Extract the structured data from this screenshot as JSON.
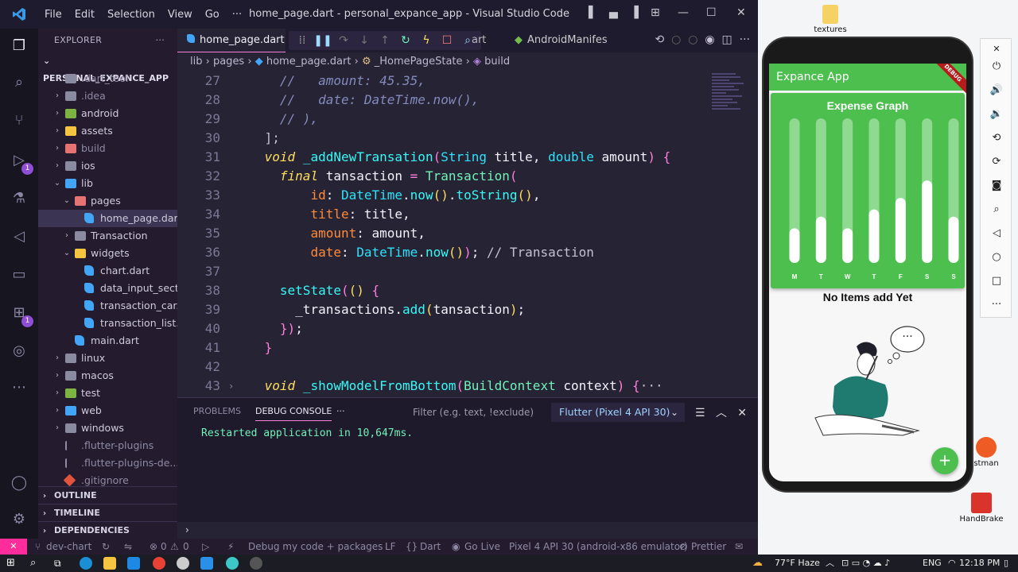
{
  "window": {
    "title": "home_page.dart - personal_expance_app - Visual Studio Code",
    "menu": [
      "File",
      "Edit",
      "Selection",
      "View",
      "Go",
      "···"
    ]
  },
  "activity_badges": [
    "1",
    "1"
  ],
  "explorer": {
    "title": "EXPLORER",
    "more": "···",
    "project": "PERSONAL_EXPANCE_APP",
    "tree": [
      {
        "label": ".dart_tool",
        "depth": 1,
        "chev": "›",
        "icon": "folder-gray",
        "dim": true
      },
      {
        "label": ".idea",
        "depth": 1,
        "chev": "›",
        "icon": "folder-gray",
        "dim": true
      },
      {
        "label": "android",
        "depth": 1,
        "chev": "›",
        "icon": "folder-green"
      },
      {
        "label": "assets",
        "depth": 1,
        "chev": "›",
        "icon": "folder-yellow"
      },
      {
        "label": "build",
        "depth": 1,
        "chev": "›",
        "icon": "folder-red",
        "dim": true
      },
      {
        "label": "ios",
        "depth": 1,
        "chev": "›",
        "icon": "folder-gray"
      },
      {
        "label": "lib",
        "depth": 1,
        "chev": "⌄",
        "icon": "folder-blue"
      },
      {
        "label": "pages",
        "depth": 2,
        "chev": "⌄",
        "icon": "folder-red"
      },
      {
        "label": "home_page.dart",
        "depth": 3,
        "chev": "",
        "icon": "dart",
        "selected": true
      },
      {
        "label": "Transaction",
        "depth": 2,
        "chev": "›",
        "icon": "folder-gray"
      },
      {
        "label": "widgets",
        "depth": 2,
        "chev": "⌄",
        "icon": "folder-yellow"
      },
      {
        "label": "chart.dart",
        "depth": 3,
        "chev": "",
        "icon": "dart"
      },
      {
        "label": "data_input_secti...",
        "depth": 3,
        "chev": "",
        "icon": "dart"
      },
      {
        "label": "transaction_car...",
        "depth": 3,
        "chev": "",
        "icon": "dart"
      },
      {
        "label": "transaction_list...",
        "depth": 3,
        "chev": "",
        "icon": "dart"
      },
      {
        "label": "main.dart",
        "depth": 2,
        "chev": "",
        "icon": "dart"
      },
      {
        "label": "linux",
        "depth": 1,
        "chev": "›",
        "icon": "folder-gray"
      },
      {
        "label": "macos",
        "depth": 1,
        "chev": "›",
        "icon": "folder-gray"
      },
      {
        "label": "test",
        "depth": 1,
        "chev": "›",
        "icon": "folder-green"
      },
      {
        "label": "web",
        "depth": 1,
        "chev": "›",
        "icon": "folder-blue"
      },
      {
        "label": "windows",
        "depth": 1,
        "chev": "›",
        "icon": "folder-gray"
      },
      {
        "label": ".flutter-plugins",
        "depth": 1,
        "chev": "",
        "icon": "file",
        "dim": true
      },
      {
        "label": ".flutter-plugins-de...",
        "depth": 1,
        "chev": "",
        "icon": "file",
        "dim": true
      },
      {
        "label": ".gitignore",
        "depth": 1,
        "chev": "",
        "icon": "git",
        "dim": true
      }
    ],
    "sections": [
      "OUTLINE",
      "TIMELINE",
      "DEPENDENCIES"
    ]
  },
  "tabs": {
    "active": "home_page.dart",
    "partial": "art",
    "second": "AndroidManifes"
  },
  "breadcrumb": {
    "lib": "lib",
    "pages": "pages",
    "file": "home_page.dart",
    "cls": "_HomePageState",
    "method": "build"
  },
  "code_lines": [
    {
      "n": "27",
      "fold": "",
      "html": "<span class='cm'>   //   amount: 45.35,</span>"
    },
    {
      "n": "28",
      "fold": "",
      "html": "<span class='cm'>   //   date: DateTime.now(),</span>"
    },
    {
      "n": "29",
      "fold": "",
      "html": "<span class='cm'>   // ),</span>"
    },
    {
      "n": "30",
      "fold": "",
      "html": " <span class='ct'>];</span>"
    },
    {
      "n": "31",
      "fold": "",
      "html": " <span class='kwi'>void</span> <span class='fn'>_addNewTransation</span><span class='kp'>(</span><span class='tyb'>String</span> title, <span class='tyb'>double</span> amount<span class='kp'>)</span> <span class='kp'>{</span>"
    },
    {
      "n": "32",
      "fold": "",
      "html": "   <span class='kwi'>final</span> tansaction <span class='kp'>=</span> <span class='ty'>Transaction</span><span class='kp'>(</span>"
    },
    {
      "n": "33",
      "fold": "",
      "html": "       <span class='pr'>id</span>: <span class='tyb'>DateTime</span>.<span class='fn'>now</span><span class='kw'>()</span>.<span class='fn'>toString</span><span class='kw'>()</span>,"
    },
    {
      "n": "34",
      "fold": "",
      "html": "       <span class='pr'>title</span>: title,"
    },
    {
      "n": "35",
      "fold": "",
      "html": "       <span class='pr'>amount</span>: amount,"
    },
    {
      "n": "36",
      "fold": "",
      "html": "       <span class='pr'>date</span>: <span class='tyb'>DateTime</span>.<span class='fn'>now</span><span class='kw'>()</span><span class='kp'>)</span>; <span class='ct'>// Transaction</span>"
    },
    {
      "n": "37",
      "fold": "",
      "html": ""
    },
    {
      "n": "38",
      "fold": "",
      "html": "   <span class='fn'>setState</span><span class='kp'>(</span><span class='kw'>()</span> <span class='kp'>{</span>"
    },
    {
      "n": "39",
      "fold": "",
      "html": "     _transactions.<span class='fn'>add</span><span class='kw'>(</span>tansaction<span class='kw'>)</span>;"
    },
    {
      "n": "40",
      "fold": "",
      "html": "   <span class='kp'>}</span><span class='kp'>)</span>;"
    },
    {
      "n": "41",
      "fold": "",
      "html": " <span class='kp'>}</span>"
    },
    {
      "n": "42",
      "fold": "",
      "html": ""
    },
    {
      "n": "43",
      "fold": "›",
      "html": " <span class='kwi'>void</span> <span class='fn'>_showModelFromBottom</span><span class='kp'>(</span><span class='ty'>BuildContext</span> context<span class='kp'>)</span> <span class='kp'>{</span><span class='ct'>···</span>"
    }
  ],
  "panel": {
    "tab_problems": "PROBLEMS",
    "tab_console": "DEBUG CONSOLE",
    "more": "···",
    "filter_placeholder": "Filter (e.g. text, !exclude)",
    "device": "Flutter (Pixel 4 API 30)",
    "output": "Restarted application in 10,647ms.",
    "prompt": "›"
  },
  "status": {
    "branch": "dev-chart",
    "errors": "0",
    "warnings": "0",
    "debug": "Debug my code + packages",
    "eol": "LF",
    "lang": "Dart",
    "live": "Go Live",
    "device": "Pixel 4 API 30 (android-x86 emulator)",
    "prettier": "Prettier"
  },
  "app": {
    "title": "Expance App",
    "debug_banner": "DEBUG",
    "empty_text": "No Items add Yet",
    "thought": "···",
    "fab": "+"
  },
  "chart_data": {
    "type": "bar",
    "title": "Expense Graph",
    "categories": [
      "M",
      "T",
      "W",
      "T",
      "F",
      "S",
      "S"
    ],
    "values": [
      0.24,
      0.32,
      0.24,
      0.37,
      0.45,
      0.57,
      0.32
    ],
    "ylim": [
      0,
      1
    ],
    "bar_color": "#ffffff",
    "track_color": "#8fd991",
    "background": "#4cbf4f"
  },
  "desktop": {
    "textures": "textures",
    "postman": "stman",
    "handbrake": "HandBrake"
  },
  "taskbar": {
    "weather": "77°F  Haze",
    "lang": "ENG",
    "time": "12:18 PM"
  },
  "colors": {
    "accent": "#ff7edb",
    "remote": "#ff2d9b",
    "app_green": "#4cbf4f"
  }
}
